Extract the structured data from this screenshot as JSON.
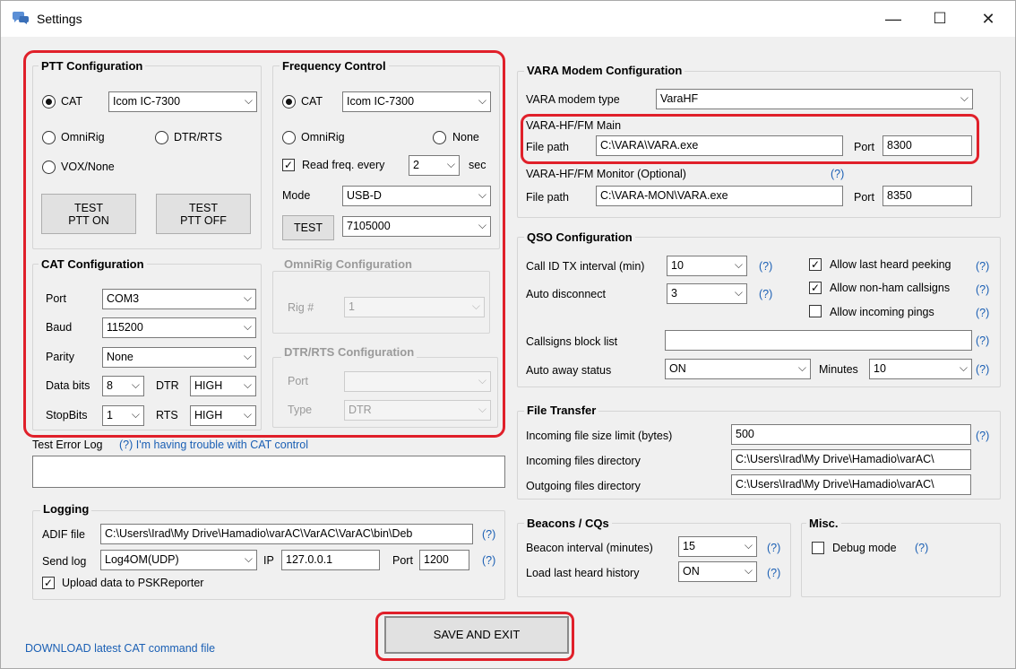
{
  "window": {
    "title": "Settings",
    "minimize": "—",
    "maximize": "☐",
    "close": "✕"
  },
  "ptt": {
    "title": "PTT Configuration",
    "cat_label": "CAT",
    "cat_selected": true,
    "cat_value": "Icom IC-7300",
    "omnirig_label": "OmniRig",
    "dtrrts_label": "DTR/RTS",
    "vox_label": "VOX/None",
    "test_on": "TEST\nPTT ON",
    "test_off": "TEST\nPTT OFF"
  },
  "freq": {
    "title": "Frequency Control",
    "cat_label": "CAT",
    "cat_selected": true,
    "cat_value": "Icom IC-7300",
    "omnirig_label": "OmniRig",
    "none_label": "None",
    "read_label": "Read freq. every",
    "read_checked": true,
    "read_value": "2",
    "read_unit": "sec",
    "mode_label": "Mode",
    "mode_value": "USB-D",
    "test_label": "TEST",
    "freq_value": "7105000"
  },
  "cat": {
    "title": "CAT Configuration",
    "port_label": "Port",
    "port_value": "COM3",
    "baud_label": "Baud",
    "baud_value": "115200",
    "parity_label": "Parity",
    "parity_value": "None",
    "databits_label": "Data bits",
    "databits_value": "8",
    "dtr_label": "DTR",
    "dtr_value": "HIGH",
    "stopbits_label": "StopBits",
    "stopbits_value": "1",
    "rts_label": "RTS",
    "rts_value": "HIGH"
  },
  "omnirig_cfg": {
    "title": "OmniRig Configuration",
    "rig_label": "Rig #",
    "rig_value": "1"
  },
  "dtrrts_cfg": {
    "title": "DTR/RTS Configuration",
    "port_label": "Port",
    "port_value": "",
    "type_label": "Type",
    "type_value": "DTR"
  },
  "errorlog": {
    "label": "Test Error Log",
    "help_link": "(?) I'm having trouble with CAT control",
    "value": ""
  },
  "logging": {
    "title": "Logging",
    "adif_label": "ADIF file",
    "adif_value": "C:\\Users\\Irad\\My Drive\\Hamadio\\varAC\\VarAC\\VarAC\\bin\\Deb",
    "send_label": "Send log",
    "send_value": "Log4OM(UDP)",
    "ip_label": "IP",
    "ip_value": "127.0.0.1",
    "port_label": "Port",
    "port_value": "1200",
    "psk_label": "Upload data to PSKReporter",
    "psk_checked": true
  },
  "vara": {
    "title": "VARA Modem Configuration",
    "type_label": "VARA modem type",
    "type_value": "VaraHF",
    "main_title": "VARA-HF/FM Main",
    "main_path_label": "File path",
    "main_path_value": "C:\\VARA\\VARA.exe",
    "main_port_label": "Port",
    "main_port_value": "8300",
    "mon_title": "VARA-HF/FM Monitor (Optional)",
    "mon_path_label": "File path",
    "mon_path_value": "C:\\VARA-MON\\VARA.exe",
    "mon_port_label": "Port",
    "mon_port_value": "8350"
  },
  "qso": {
    "title": "QSO Configuration",
    "callid_label": "Call ID TX interval (min)",
    "callid_value": "10",
    "autodisc_label": "Auto disconnect",
    "autodisc_value": "3",
    "peek_label": "Allow last heard peeking",
    "peek_checked": true,
    "nonham_label": "Allow non-ham callsigns",
    "nonham_checked": true,
    "pings_label": "Allow incoming pings",
    "pings_checked": false,
    "block_label": "Callsigns block list",
    "block_value": "",
    "away_label": "Auto away status",
    "away_value": "ON",
    "minutes_label": "Minutes",
    "minutes_value": "10"
  },
  "file": {
    "title": "File Transfer",
    "limit_label": "Incoming file size limit (bytes)",
    "limit_value": "500",
    "in_label": "Incoming files directory",
    "in_value": "C:\\Users\\Irad\\My Drive\\Hamadio\\varAC\\",
    "out_label": "Outgoing files directory",
    "out_value": "C:\\Users\\Irad\\My Drive\\Hamadio\\varAC\\"
  },
  "beacons": {
    "title": "Beacons / CQs",
    "interval_label": "Beacon interval (minutes)",
    "interval_value": "15",
    "history_label": "Load last heard history",
    "history_value": "ON"
  },
  "misc": {
    "title": "Misc.",
    "debug_label": "Debug mode",
    "debug_checked": false
  },
  "help": "(?)",
  "footer": {
    "download_link": "DOWNLOAD latest CAT command file",
    "save_label": "SAVE AND EXIT"
  },
  "colors": {
    "highlight": "#e0202a",
    "link": "#1a5fb4",
    "window_bg": "#f0f0f0"
  }
}
